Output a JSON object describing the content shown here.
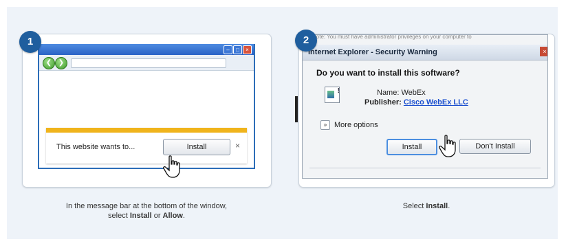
{
  "steps": [
    "1",
    "2"
  ],
  "panel1": {
    "message": "This website wants to...",
    "install_label": "Install",
    "close_glyph": "×",
    "window_controls": [
      "–",
      "□",
      "×"
    ],
    "nav": {
      "back": "❮",
      "forward": "❯"
    }
  },
  "panel2": {
    "note": "Note: You must have administrator privileges on your computer to",
    "title": "Internet Explorer - Security Warning",
    "close_glyph": "×",
    "question": "Do you want to install this software?",
    "name_label": "Name:",
    "name_value": "WebEx",
    "publisher_label": "Publisher:",
    "publisher_value": "Cisco WebEx LLC",
    "more_options_glyph": "»",
    "more_options": "More options",
    "install_label": "Install",
    "dont_install_label": "Don't Install",
    "icon_glyph": "!"
  },
  "captions": {
    "step1": {
      "pre": "In the message bar at the bottom of the window,",
      "select": "select ",
      "install": "Install",
      "or": " or ",
      "allow": "Allow",
      "end": "."
    },
    "step2": {
      "pre": "Select ",
      "install": "Install",
      "end": "."
    }
  },
  "colors": {
    "step_badge": "#1f5e9e",
    "message_bar_accent": "#f0b41c",
    "titlebar_blue": "#2c6db8",
    "link_blue": "#1b4fcf"
  },
  "icons": [
    "hand-pointer-icon",
    "back-arrow-icon",
    "forward-arrow-icon",
    "close-icon",
    "software-icon",
    "chevron-double-icon"
  ]
}
